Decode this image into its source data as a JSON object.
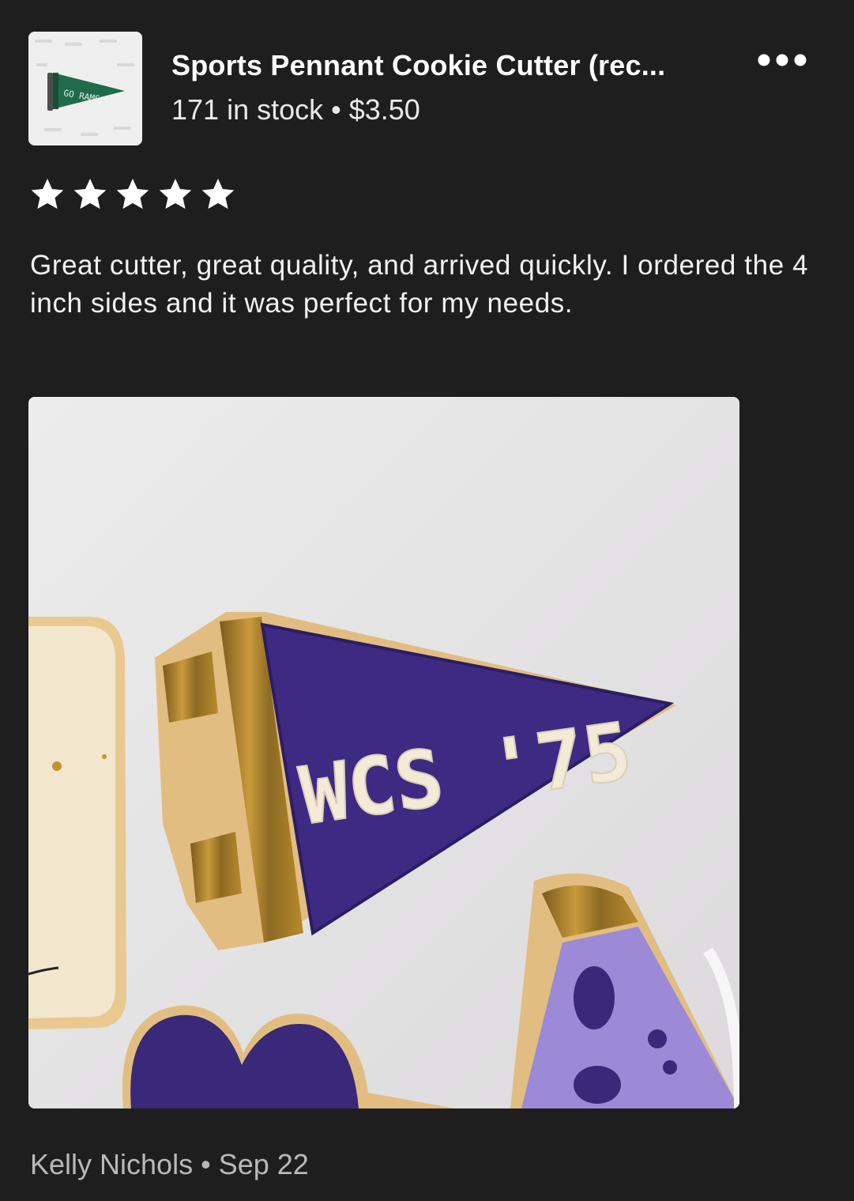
{
  "listing": {
    "title": "Sports Pennant Cookie Cutter (rec...",
    "stock": "171 in stock",
    "separator": "•",
    "price": "$3.50",
    "thumbnail_pennant_text": "GO RAMS"
  },
  "menu": {
    "icon": "more-horizontal-icon"
  },
  "review": {
    "rating": 5,
    "rating_max": 5,
    "text": "Great cutter, great quality, and arrived quickly. I ordered the 4 inch sides and it was perfect for my needs.",
    "photo_cookie_text": "WCS '75",
    "author": "Kelly Nichols",
    "separator": "•",
    "date": "Sep 22"
  },
  "colors": {
    "background": "#1e1e1e",
    "text_primary": "#ffffff",
    "text_secondary": "#b9b9b9",
    "star": "#ffffff",
    "pennant_green": "#1f6b4a",
    "cookie_purple": "#3e2a82",
    "cookie_gold": "#b98a2c"
  }
}
